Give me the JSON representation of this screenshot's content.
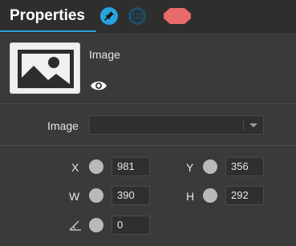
{
  "header": {
    "title": "Properties",
    "icons": [
      "pin-icon",
      "globe-icon",
      "octagon-icon"
    ],
    "accent_color": "#29a3e0",
    "octagon_color": "#e86a6a"
  },
  "image_section": {
    "title": "Image",
    "visibility_icon": "eye-icon"
  },
  "image_field": {
    "label": "Image",
    "value": ""
  },
  "transform": {
    "x": {
      "label": "X",
      "value": "981"
    },
    "y": {
      "label": "Y",
      "value": "356"
    },
    "w": {
      "label": "W",
      "value": "390"
    },
    "h": {
      "label": "H",
      "value": "292"
    },
    "rotation": {
      "icon": "angle-icon",
      "value": "0"
    }
  }
}
